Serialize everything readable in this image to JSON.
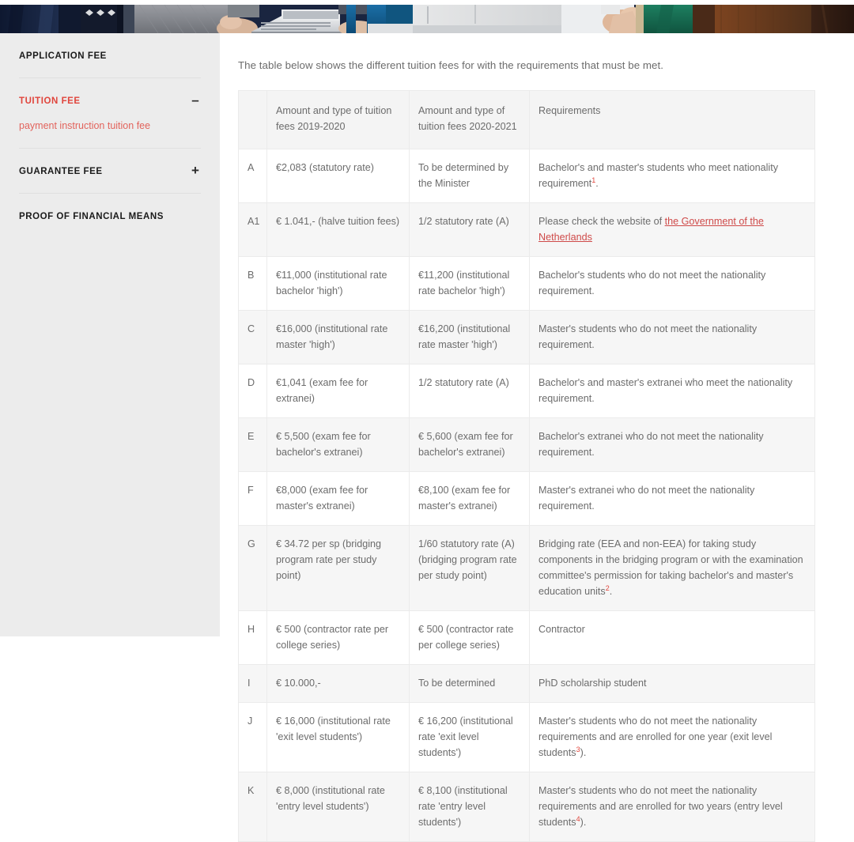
{
  "hero": {
    "alt": "students working on laptops at a table",
    "colors": [
      "#1d2b4a",
      "#2c3c5e",
      "#8e8f93",
      "#c9cdd2",
      "#1a6fa8",
      "#e8e9ea",
      "#1f7a5e",
      "#6b3a1e",
      "#8a4a20",
      "#3a2418"
    ]
  },
  "sidebar": {
    "items": [
      {
        "label": "APPLICATION FEE",
        "toggle": "",
        "active": false,
        "sublinks": []
      },
      {
        "label": "TUITION FEE",
        "toggle": "–",
        "active": true,
        "sublinks": [
          "payment instruction tuition fee"
        ]
      },
      {
        "label": "GUARANTEE FEE",
        "toggle": "+",
        "active": false,
        "sublinks": []
      },
      {
        "label": "PROOF OF FINANCIAL MEANS",
        "toggle": "",
        "active": false,
        "sublinks": []
      }
    ]
  },
  "main": {
    "intro": "The table below shows the different tuition fees for with the requirements that must be met.",
    "table": {
      "headers": [
        "",
        "Amount and type of tuition fees 2019-2020",
        "Amount and type of tuition fees 2020-2021",
        "Requirements"
      ],
      "rows": [
        {
          "code": "A",
          "y1": "€2,083 (statutory rate)",
          "y2": "To be determined by the Minister",
          "req_pre": "Bachelor's and master's students who meet nationality requirement",
          "req_sup": "1",
          "req_post": ".",
          "link_pre": "",
          "link_text": "",
          "link_post": ""
        },
        {
          "code": "A1",
          "y1": "€ 1.041,- (halve tuition fees)",
          "y2": "1/2 statutory rate (A)",
          "req_pre": "",
          "req_sup": "",
          "req_post": "",
          "link_pre": "Please check the website of ",
          "link_text": "the Government of the Netherlands",
          "link_post": ""
        },
        {
          "code": "B",
          "y1": "€11,000 (institutional rate bachelor 'high')",
          "y2": "€11,200 (institutional rate bachelor 'high')",
          "req_pre": "Bachelor's students who do not meet the nationality requirement.",
          "req_sup": "",
          "req_post": "",
          "link_pre": "",
          "link_text": "",
          "link_post": ""
        },
        {
          "code": "C",
          "y1": "€16,000 (institutional rate master 'high')",
          "y2": "€16,200 (institutional rate master 'high')",
          "req_pre": "Master's students who do not meet the nationality requirement.",
          "req_sup": "",
          "req_post": "",
          "link_pre": "",
          "link_text": "",
          "link_post": ""
        },
        {
          "code": "D",
          "y1": "€1,041 (exam fee for extranei)",
          "y2": "1/2 statutory rate (A)",
          "req_pre": "Bachelor's and master's extranei who meet the nationality requirement.",
          "req_sup": "",
          "req_post": "",
          "link_pre": "",
          "link_text": "",
          "link_post": ""
        },
        {
          "code": "E",
          "y1": "€ 5,500 (exam fee for bachelor's extranei)",
          "y2": "€ 5,600 (exam fee for bachelor's extranei)",
          "req_pre": "Bachelor's extranei who do not meet the nationality requirement.",
          "req_sup": "",
          "req_post": "",
          "link_pre": "",
          "link_text": "",
          "link_post": ""
        },
        {
          "code": "F",
          "y1": "€8,000 (exam fee for master's extranei)",
          "y2": "€8,100 (exam fee for master's extranei)",
          "req_pre": "Master's extranei who do not meet the nationality requirement.",
          "req_sup": "",
          "req_post": "",
          "link_pre": "",
          "link_text": "",
          "link_post": ""
        },
        {
          "code": "G",
          "y1": "€ 34.72 per sp (bridging program rate per study point)",
          "y2": "1/60 statutory rate (A) (bridging program rate per study point)",
          "req_pre": "Bridging rate (EEA and non-EEA) for taking study components in the bridging program or with the examination committee's permission for taking bachelor's and master's education units",
          "req_sup": "2",
          "req_post": ".",
          "link_pre": "",
          "link_text": "",
          "link_post": ""
        },
        {
          "code": "H",
          "y1": "€ 500 (contractor rate per college series)",
          "y2": "€ 500 (contractor rate per college series)",
          "req_pre": "Contractor",
          "req_sup": "",
          "req_post": "",
          "link_pre": "",
          "link_text": "",
          "link_post": ""
        },
        {
          "code": "I",
          "y1": "€ 10.000,-",
          "y2": "To be determined",
          "req_pre": "PhD scholarship student",
          "req_sup": "",
          "req_post": "",
          "link_pre": "",
          "link_text": "",
          "link_post": ""
        },
        {
          "code": "J",
          "y1": "€ 16,000 (institutional rate 'exit level students')",
          "y2": "€ 16,200 (institutional rate 'exit level students')",
          "req_pre": "Master's students who do not meet the nationality requirements and are enrolled for one year (exit level students",
          "req_sup": "3",
          "req_post": ").",
          "link_pre": "",
          "link_text": "",
          "link_post": ""
        },
        {
          "code": "K",
          "y1": "€ 8,000 (institutional rate 'entry level students')",
          "y2": "€ 8,100 (institutional rate 'entry level students')",
          "req_pre": "Master's students who do not meet the nationality requirements and are enrolled for two years (entry level students",
          "req_sup": "4",
          "req_post": ").",
          "link_pre": "",
          "link_text": "",
          "link_post": ""
        }
      ]
    }
  },
  "colors": {
    "accent_red": "#e0453c",
    "link_red": "#cf4a49",
    "sidebar_bg": "#ececec",
    "stripe_bg": "#f6f6f6",
    "text_gray": "#6c6c6c"
  }
}
